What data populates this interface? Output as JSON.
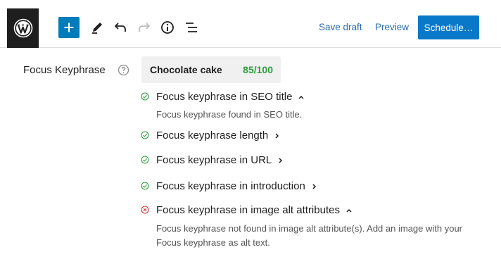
{
  "toolbar": {
    "logo_icon": "wordpress-icon",
    "add_icon": "plus-icon",
    "tools": [
      "pencil-icon",
      "undo-icon",
      "redo-icon",
      "info-icon",
      "list-view-icon"
    ],
    "save_draft_label": "Save draft",
    "preview_label": "Preview",
    "schedule_label": "Schedule…",
    "accent_color": "#007cba"
  },
  "focus": {
    "label": "Focus Keyphrase",
    "help_icon": "help-circle-icon",
    "keyphrase": "Chocolate cake",
    "score": "85/100",
    "score_color": "#2e9e3e"
  },
  "checks": [
    {
      "title": "Focus keyphrase in SEO title",
      "status": "pass",
      "expanded": true,
      "description": "Focus keyphrase found in SEO title."
    },
    {
      "title": "Focus keyphrase length",
      "status": "pass",
      "expanded": false
    },
    {
      "title": "Focus keyphrase in URL",
      "status": "pass",
      "expanded": false
    },
    {
      "title": "Focus keyphrase in introduction",
      "status": "pass",
      "expanded": false
    },
    {
      "title": "Focus keyphrase in image alt attributes",
      "status": "fail",
      "expanded": true,
      "description_line1": "Focus keyphrase not found in image alt attribute(s). Add an image with your",
      "description_line2": "Focus keyphrase as alt text."
    }
  ],
  "status_colors": {
    "pass": "#2e9e3e",
    "fail": "#d63638"
  }
}
